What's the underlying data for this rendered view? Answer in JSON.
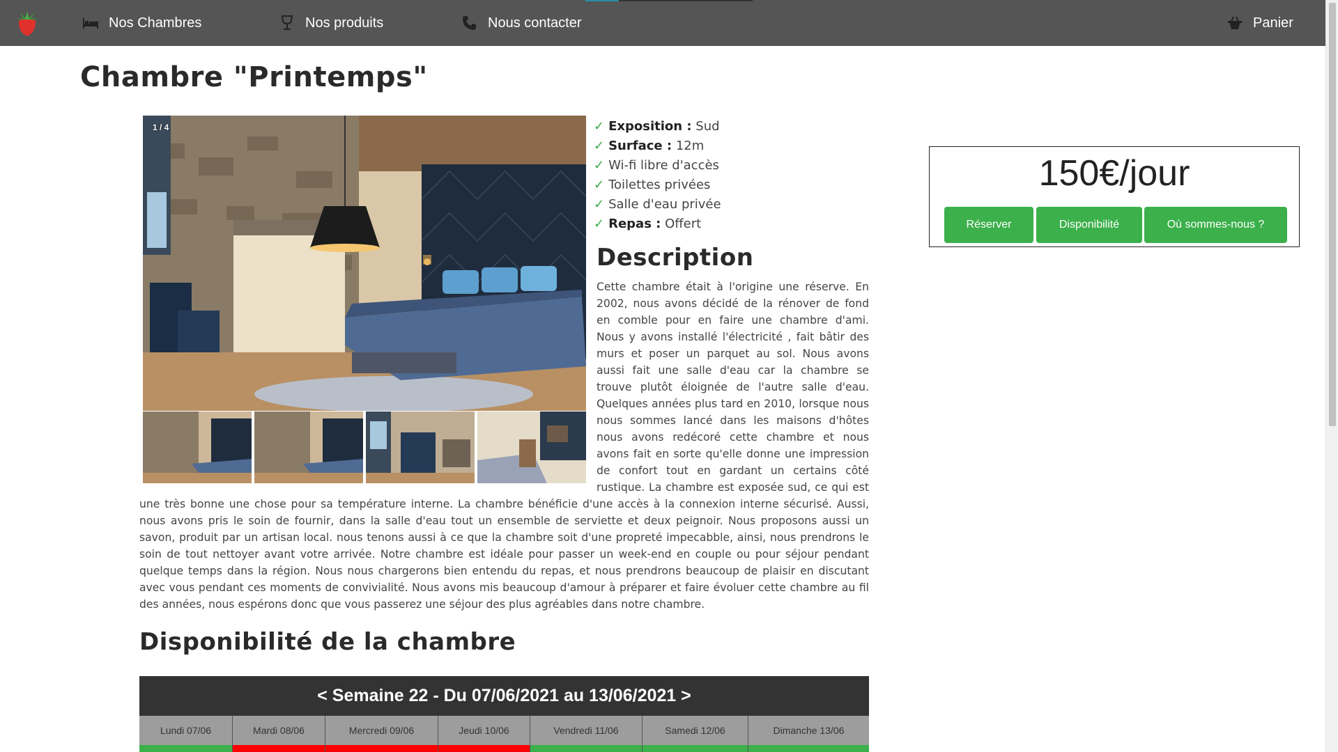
{
  "nav": {
    "items": [
      {
        "label": "Nos Chambres",
        "icon": "bed-icon"
      },
      {
        "label": "Nos produits",
        "icon": "wine-glass-icon"
      },
      {
        "label": "Nous contacter",
        "icon": "phone-icon"
      }
    ],
    "cart_label": "Panier",
    "logo": "strawberry-logo"
  },
  "room": {
    "title": "Chambre \"Printemps\"",
    "photo_counter": "1 / 4",
    "features": [
      {
        "label": "Exposition :",
        "value": "Sud"
      },
      {
        "label": "Surface :",
        "value": "12m"
      },
      {
        "label": "",
        "value": "Wi-fi libre d'accès"
      },
      {
        "label": "",
        "value": "Toilettes privées"
      },
      {
        "label": "",
        "value": "Salle d'eau privée"
      },
      {
        "label": "Repas :",
        "value": "Offert"
      }
    ],
    "description_title": "Description",
    "description": "Cette chambre était à l'origine une réserve. En 2002, nous avons décidé de la rénover de fond en comble pour en faire une chambre d'ami. Nous y avons installé l'électricité , fait bâtir des murs et poser un parquet au sol. Nous avons aussi fait une salle d'eau car la chambre se trouve plutôt éloignée de l'autre salle d'eau. Quelques années plus tard en 2010, lorsque nous nous sommes lancé dans les maisons d'hôtes nous avons redécoré cette chambre et nous avons fait en sorte qu'elle donne une impression de confort tout en gardant un certains côté rustique. La chambre est exposée sud, ce qui est une très bonne une chose pour sa température interne. La chambre bénéficie d'une accès à la connexion interne sécurisé. Aussi, nous avons pris le soin de fournir, dans la salle d'eau tout un ensemble de serviette et deux peignoir. Nous proposons aussi un savon, produit par un artisan local. nous tenons aussi à ce que la chambre soit d'une propreté impecabble, ainsi, nous prendrons le soin de tout nettoyer avant votre arrivée. Notre chambre est idéale pour passer un week-end en couple ou pour séjour pendant quelque temps dans la région. Nous nous chargerons bien entendu du repas, et nous prendrons beaucoup de plaisir en discutant avec vous pendant ces moments de convivialité. Nous avons mis beaucoup d'amour à préparer et faire évoluer cette chambre au fil des années, nous espérons donc que vous passerez une séjour des plus agréables dans notre chambre."
  },
  "booking": {
    "price": "150€/jour",
    "reserve_label": "Réserver",
    "availability_label": "Disponibilité",
    "location_label": "Où sommes-nous ?"
  },
  "availability": {
    "title": "Disponibilité de la chambre",
    "prev": "<",
    "week": "Semaine 22 - Du 07/06/2021 au 13/06/2021",
    "next": ">",
    "days": [
      {
        "label": "Lundi 07/06",
        "status": "available"
      },
      {
        "label": "Mardi 08/06",
        "status": "booked"
      },
      {
        "label": "Mercredi 09/06",
        "status": "booked"
      },
      {
        "label": "Jeudi 10/06",
        "status": "booked"
      },
      {
        "label": "Vendredi 11/06",
        "status": "available"
      },
      {
        "label": "Samedi 12/06",
        "status": "available"
      },
      {
        "label": "Dimanche 13/06",
        "status": "available"
      }
    ]
  },
  "colors": {
    "navbar": "#555555",
    "accent_green": "#3cb04b",
    "available": "#3cb04b",
    "booked": "#ff0000",
    "calendar_header": "#333333",
    "check": "#3aa84a"
  }
}
